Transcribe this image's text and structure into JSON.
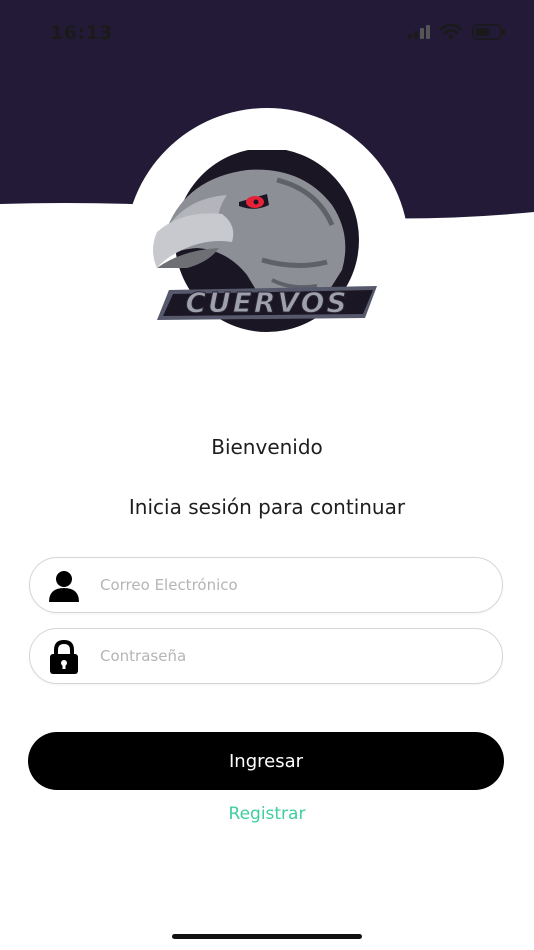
{
  "status_bar": {
    "time": "16:13"
  },
  "colors": {
    "header_bg": "#221a36",
    "accent_register": "#3fcf9c",
    "button_bg": "#000000",
    "button_text": "#ffffff",
    "eye_red": "#e52238"
  },
  "logo": {
    "text": "CUERVOS",
    "icon": "raven-icon"
  },
  "welcome": "Bienvenido",
  "subtitle": "Inicia sesión para continuar",
  "form": {
    "email": {
      "placeholder": "Correo Electrónico",
      "value": "",
      "icon": "user-icon"
    },
    "password": {
      "placeholder": "Contraseña",
      "value": "",
      "icon": "lock-icon"
    },
    "submit_label": "Ingresar",
    "register_label": "Registrar"
  }
}
